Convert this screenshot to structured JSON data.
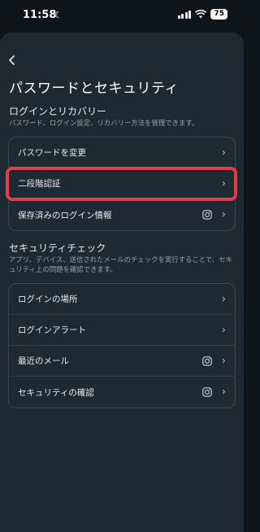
{
  "status": {
    "time": "11:58",
    "battery": "75"
  },
  "header": {
    "back_icon": "chevron-left-icon",
    "title": "パスワードとセキュリティ"
  },
  "login_section": {
    "title": "ログインとリカバリー",
    "description": "パスワード、ログイン設定、リカバリー方法を管理できます。",
    "items": [
      {
        "label": "パスワードを変更"
      },
      {
        "label": "二段階認証"
      },
      {
        "label": "保存済みのログイン情報",
        "icon": "instagram-icon"
      }
    ]
  },
  "security_section": {
    "title": "セキュリティチェック",
    "description": "アプリ、デバイス、送信されたメールのチェックを実行することで、セキュリティ上の問題を確認できます。",
    "items": [
      {
        "label": "ログインの場所"
      },
      {
        "label": "ログインアラート"
      },
      {
        "label": "最近のメール",
        "icon": "instagram-icon"
      },
      {
        "label": "セキュリティの確認",
        "icon": "instagram-icon"
      }
    ]
  },
  "colors": {
    "highlight": "#e03f4a",
    "background": "#1e2a33"
  }
}
